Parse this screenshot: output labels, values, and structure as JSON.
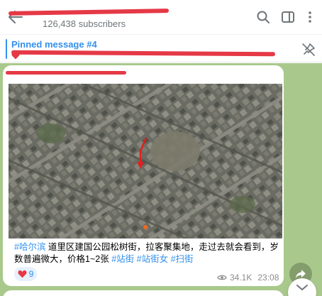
{
  "header": {
    "title": "",
    "subscribers": "126,438 subscribers"
  },
  "pinned": {
    "title": "Pinned message #4",
    "text": ""
  },
  "message": {
    "sender": "",
    "text_parts": [
      {
        "text": "#哈尔滨",
        "tag": true
      },
      {
        "text": " 道里区建国公园松树街，拉客聚集地，走过去就会看到，岁数普遍微大，价格1~2张 ",
        "tag": false
      },
      {
        "text": "#站街",
        "tag": true
      },
      {
        "text": " ",
        "tag": false
      },
      {
        "text": "#站街女",
        "tag": true
      },
      {
        "text": " ",
        "tag": false
      },
      {
        "text": "#扫街",
        "tag": true
      }
    ],
    "reaction_count": "9",
    "views": "34.1K",
    "time": "23:08"
  },
  "icons": {
    "back": "back-arrow-icon",
    "search": "search-icon",
    "sidebar": "sidebar-toggle-icon",
    "more": "more-vertical-icon",
    "unpin": "unpin-icon",
    "heart": "heart-icon",
    "views": "eye-icon",
    "forward": "forward-icon",
    "scroll": "chevron-down-icon"
  },
  "colors": {
    "accent": "#3390ec",
    "redaction": "#e53946",
    "chat_background": "#a9c98c"
  }
}
